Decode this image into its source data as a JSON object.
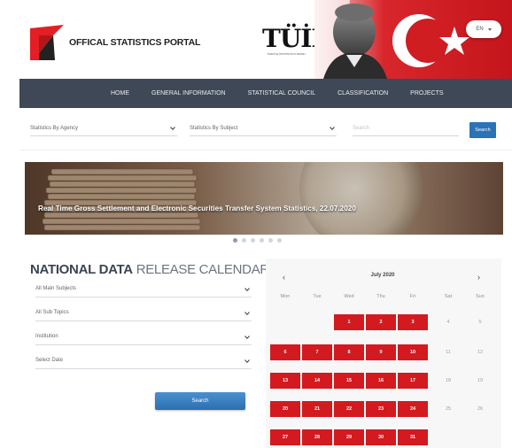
{
  "header": {
    "portal_title": "OFFICAL STATISTICS PORTAL",
    "tuik_wordmark": "TÜİK",
    "tuik_tagline": "TÜRKİYE İSTATİSTİK KURUMU",
    "language": "EN"
  },
  "nav": {
    "items": [
      {
        "label": "HOME"
      },
      {
        "label": "GENERAL INFORMATION"
      },
      {
        "label": "STATISTICAL COUNCIL"
      },
      {
        "label": "CLASSIFICATION"
      },
      {
        "label": "PROJECTS"
      }
    ]
  },
  "filters": {
    "by_agency": "Statistics By Agency",
    "by_subject": "Statistics By Subject",
    "search_placeholder": "Search",
    "search_button": "Search"
  },
  "banner": {
    "caption": "Real Time Gross Settlement and Electronic Securities Transfer System Statistics, 22.07.2020",
    "slide_count": 6,
    "active_slide": 1
  },
  "calendar": {
    "title_bold": "NATIONAL DATA",
    "title_light": "RELEASE CALENDAR",
    "fields": [
      {
        "label": "All Main Subjects"
      },
      {
        "label": "All Sub Topics"
      },
      {
        "label": "Institution"
      },
      {
        "label": "Select Date"
      }
    ],
    "search_button": "Search",
    "prev": "‹",
    "next": "›",
    "month": "July 2020",
    "weekdays": [
      "Mon",
      "Tue",
      "Wed",
      "Thu",
      "Fri",
      "Sat",
      "Sun"
    ],
    "days": [
      {
        "n": "1",
        "active": true
      },
      {
        "n": "2",
        "active": true
      },
      {
        "n": "3",
        "active": true
      },
      {
        "n": "4",
        "active": false
      },
      {
        "n": "5",
        "active": false
      },
      {
        "n": "6",
        "active": true
      },
      {
        "n": "7",
        "active": true
      },
      {
        "n": "8",
        "active": true
      },
      {
        "n": "9",
        "active": true
      },
      {
        "n": "10",
        "active": true
      },
      {
        "n": "11",
        "active": false
      },
      {
        "n": "12",
        "active": false
      },
      {
        "n": "13",
        "active": true
      },
      {
        "n": "14",
        "active": true
      },
      {
        "n": "15",
        "active": true
      },
      {
        "n": "16",
        "active": true
      },
      {
        "n": "17",
        "active": true
      },
      {
        "n": "18",
        "active": false
      },
      {
        "n": "19",
        "active": false
      },
      {
        "n": "20",
        "active": true
      },
      {
        "n": "21",
        "active": true
      },
      {
        "n": "22",
        "active": true
      },
      {
        "n": "23",
        "active": true
      },
      {
        "n": "24",
        "active": true
      },
      {
        "n": "25",
        "active": false
      },
      {
        "n": "26",
        "active": false
      },
      {
        "n": "27",
        "active": true
      },
      {
        "n": "28",
        "active": true
      },
      {
        "n": "29",
        "active": true
      },
      {
        "n": "30",
        "active": true
      },
      {
        "n": "31",
        "active": true
      }
    ]
  },
  "colors": {
    "brand_red": "#d21a1f",
    "nav_bg": "#3e4856",
    "button_blue": "#2b73b6"
  }
}
